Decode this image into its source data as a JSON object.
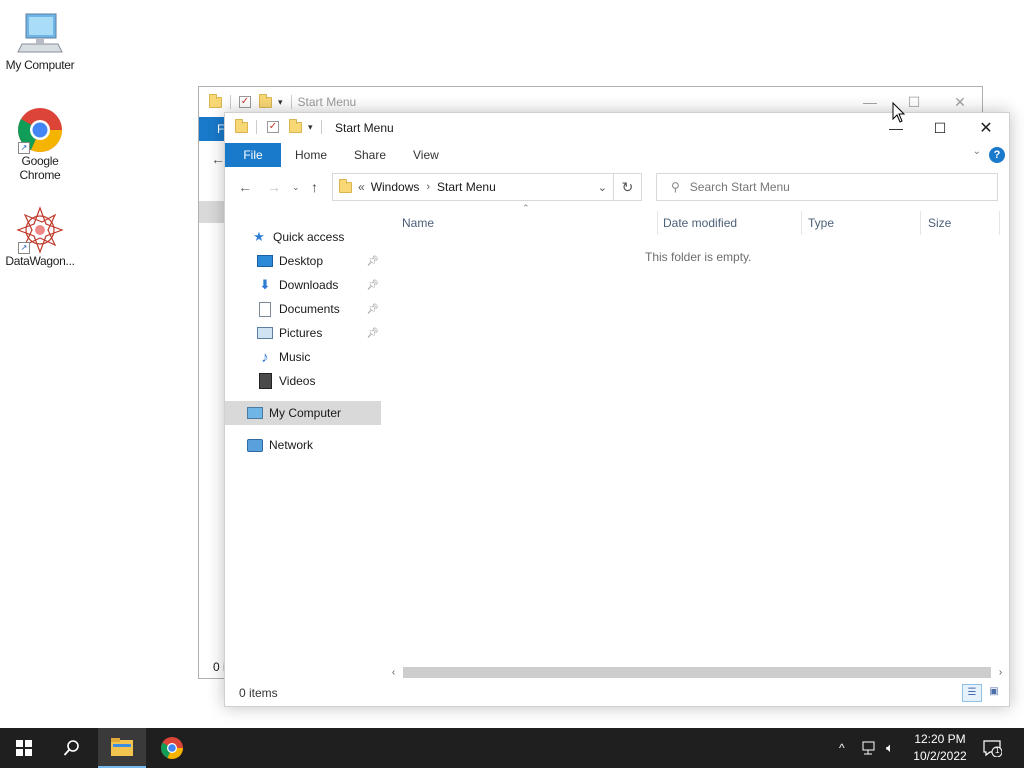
{
  "desktop": {
    "icons": [
      {
        "label": "My Computer"
      },
      {
        "label": "Google Chrome"
      },
      {
        "label": "DataWagon..."
      }
    ]
  },
  "background_window": {
    "title": "Start Menu",
    "status_fragment": "0 i",
    "file_tab_fragment": "F"
  },
  "window": {
    "title": "Start Menu",
    "ribbon_tabs": [
      "File",
      "Home",
      "Share",
      "View"
    ],
    "address": {
      "overflow": "«",
      "crumbs": [
        "Windows",
        "Start Menu"
      ]
    },
    "search_placeholder": "Search Start Menu",
    "nav": {
      "quick_access": "Quick access",
      "items": [
        "Desktop",
        "Downloads",
        "Documents",
        "Pictures",
        "Music",
        "Videos"
      ],
      "my_computer": "My Computer",
      "network": "Network"
    },
    "columns": [
      "Name",
      "Date modified",
      "Type",
      "Size"
    ],
    "empty_message": "This folder is empty.",
    "status": "0 items"
  },
  "taskbar": {
    "time": "12:20 PM",
    "date": "10/2/2022",
    "notification_count": "1"
  },
  "colors": {
    "accent": "#1979ca",
    "taskbar": "#1f1f1f",
    "selection": "#d9d9d9"
  }
}
